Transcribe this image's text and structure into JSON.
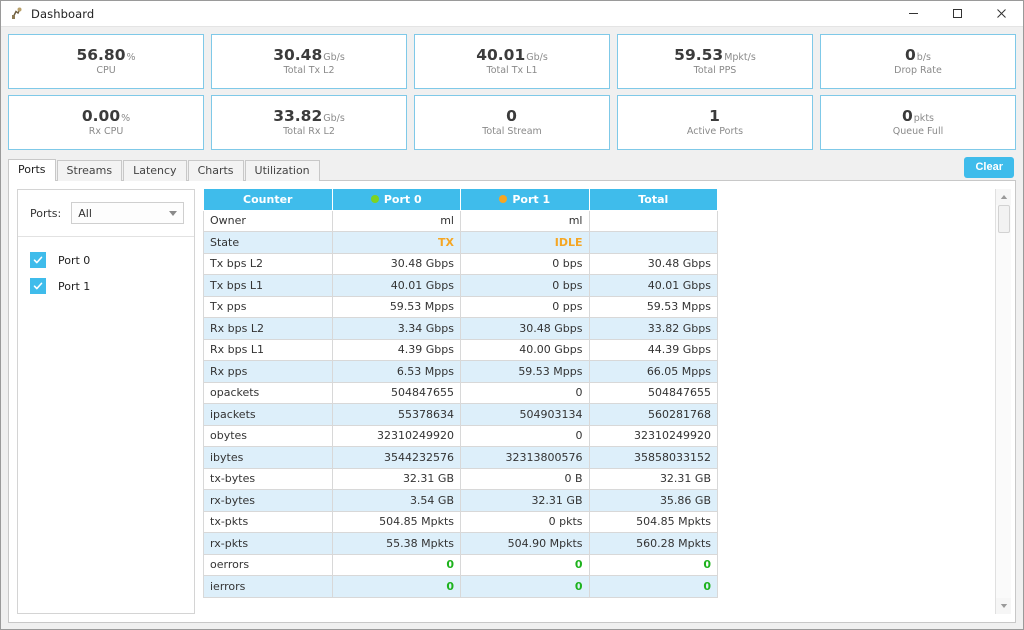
{
  "window": {
    "title": "Dashboard",
    "icon": "app-icon",
    "controls": {
      "minimize": "minimize-icon",
      "maximize": "maximize-icon",
      "close": "close-icon"
    }
  },
  "colors": {
    "accent": "#3fbceb",
    "card_border": "#7fc9e8",
    "row_alt": "#ddeffa",
    "state_text": "#f5a623",
    "ok_green": "#1db21d",
    "port0_dot": "#7ed321",
    "port1_dot": "#f5a623"
  },
  "cards": [
    {
      "value": "56.80",
      "unit": "%",
      "label": "CPU"
    },
    {
      "value": "30.48",
      "unit": "Gb/s",
      "label": "Total Tx L2"
    },
    {
      "value": "40.01",
      "unit": "Gb/s",
      "label": "Total Tx L1"
    },
    {
      "value": "59.53",
      "unit": "Mpkt/s",
      "label": "Total PPS"
    },
    {
      "value": "0",
      "unit": "b/s",
      "label": "Drop Rate"
    },
    {
      "value": "0.00",
      "unit": "%",
      "label": "Rx CPU"
    },
    {
      "value": "33.82",
      "unit": "Gb/s",
      "label": "Total Rx L2"
    },
    {
      "value": "0",
      "unit": "",
      "label": "Total Stream"
    },
    {
      "value": "1",
      "unit": "",
      "label": "Active Ports"
    },
    {
      "value": "0",
      "unit": "pkts",
      "label": "Queue Full"
    }
  ],
  "tabs": [
    {
      "label": "Ports",
      "active": true
    },
    {
      "label": "Streams",
      "active": false
    },
    {
      "label": "Latency",
      "active": false
    },
    {
      "label": "Charts",
      "active": false
    },
    {
      "label": "Utilization",
      "active": false
    }
  ],
  "toolbar": {
    "clear_label": "Clear"
  },
  "ports_panel": {
    "label": "Ports:",
    "selected": "All",
    "options": [
      "All"
    ],
    "items": [
      {
        "name": "Port 0",
        "checked": true
      },
      {
        "name": "Port 1",
        "checked": true
      }
    ]
  },
  "table": {
    "headers": [
      "Counter",
      "Port 0",
      "Port 1",
      "Total"
    ],
    "rows": [
      {
        "counter": "Owner",
        "port0": "ml",
        "port1": "ml",
        "total": "",
        "style": "plain"
      },
      {
        "counter": "State",
        "port0": "TX",
        "port1": "IDLE",
        "total": "",
        "style": "state"
      },
      {
        "counter": "Tx bps L2",
        "port0": "30.48 Gbps",
        "port1": "0 bps",
        "total": "30.48 Gbps",
        "style": "plain"
      },
      {
        "counter": "Tx bps L1",
        "port0": "40.01 Gbps",
        "port1": "0 bps",
        "total": "40.01 Gbps",
        "style": "plain"
      },
      {
        "counter": "Tx pps",
        "port0": "59.53 Mpps",
        "port1": "0 pps",
        "total": "59.53 Mpps",
        "style": "plain"
      },
      {
        "counter": "Rx bps L2",
        "port0": "3.34 Gbps",
        "port1": "30.48 Gbps",
        "total": "33.82 Gbps",
        "style": "plain"
      },
      {
        "counter": "Rx bps L1",
        "port0": "4.39 Gbps",
        "port1": "40.00 Gbps",
        "total": "44.39 Gbps",
        "style": "plain"
      },
      {
        "counter": "Rx pps",
        "port0": "6.53 Mpps",
        "port1": "59.53 Mpps",
        "total": "66.05 Mpps",
        "style": "plain"
      },
      {
        "counter": "opackets",
        "port0": "504847655",
        "port1": "0",
        "total": "504847655",
        "style": "plain"
      },
      {
        "counter": "ipackets",
        "port0": "55378634",
        "port1": "504903134",
        "total": "560281768",
        "style": "plain"
      },
      {
        "counter": "obytes",
        "port0": "32310249920",
        "port1": "0",
        "total": "32310249920",
        "style": "plain"
      },
      {
        "counter": "ibytes",
        "port0": "3544232576",
        "port1": "32313800576",
        "total": "35858033152",
        "style": "plain"
      },
      {
        "counter": "tx-bytes",
        "port0": "32.31 GB",
        "port1": "0 B",
        "total": "32.31 GB",
        "style": "plain"
      },
      {
        "counter": "rx-bytes",
        "port0": "3.54 GB",
        "port1": "32.31 GB",
        "total": "35.86 GB",
        "style": "plain"
      },
      {
        "counter": "tx-pkts",
        "port0": "504.85 Mpkts",
        "port1": "0 pkts",
        "total": "504.85 Mpkts",
        "style": "plain"
      },
      {
        "counter": "rx-pkts",
        "port0": "55.38 Mpkts",
        "port1": "504.90 Mpkts",
        "total": "560.28 Mpkts",
        "style": "plain"
      },
      {
        "counter": "oerrors",
        "port0": "0",
        "port1": "0",
        "total": "0",
        "style": "green"
      },
      {
        "counter": "ierrors",
        "port0": "0",
        "port1": "0",
        "total": "0",
        "style": "green"
      }
    ]
  },
  "scrollbar": {
    "up": "scroll-up-icon",
    "down": "scroll-down-icon",
    "thumb": "scroll-thumb"
  }
}
